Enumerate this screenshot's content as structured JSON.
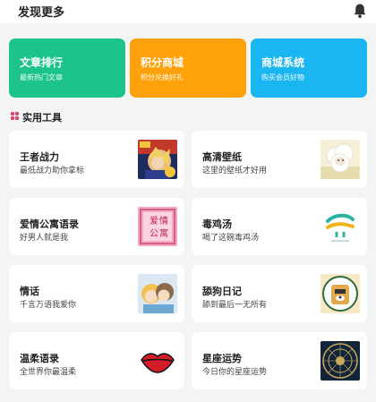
{
  "header": {
    "title": "发现更多",
    "bell_icon": "bell-icon"
  },
  "cards": [
    {
      "title": "文章排行",
      "subtitle": "最新热门文章",
      "color": "#1cc48c"
    },
    {
      "title": "积分商城",
      "subtitle": "积分兑换好礼",
      "color": "#ffa10a"
    },
    {
      "title": "商城系统",
      "subtitle": "购买会员好物",
      "color": "#1ab6f2"
    }
  ],
  "section": {
    "title": "实用工具",
    "icon": "grid-icon",
    "icon_color": "#e0456b"
  },
  "tools": [
    {
      "title": "王者战力",
      "subtitle": "最低战力助你拿标",
      "thumb": "hero-game-image"
    },
    {
      "title": "高清壁纸",
      "subtitle": "这里的壁纸才好用",
      "thumb": "sheep-wallpaper-image"
    },
    {
      "title": "爱情公寓语录",
      "subtitle": "好男人就是我",
      "thumb": "love-apartment-poster",
      "thumb_text": [
        "爱",
        "情",
        "公",
        "寓"
      ]
    },
    {
      "title": "毒鸡汤",
      "subtitle": "喝了这碗毒鸡汤",
      "thumb": "soup-logo-image"
    },
    {
      "title": "情话",
      "subtitle": "千言万语我爱你",
      "thumb": "couple-illustration"
    },
    {
      "title": "舔狗日记",
      "subtitle": "舔到最后一无所有",
      "thumb": "dog-diary-image"
    },
    {
      "title": "温柔语录",
      "subtitle": "全世界你最温柔",
      "thumb": "red-lips-icon"
    },
    {
      "title": "星座运势",
      "subtitle": "今日你的星座运势",
      "thumb": "zodiac-wheel-image"
    }
  ]
}
